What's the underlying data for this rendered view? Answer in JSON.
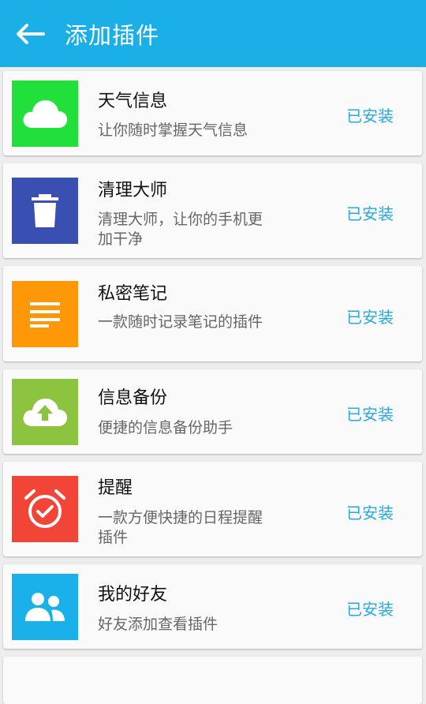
{
  "header": {
    "title": "添加插件",
    "back_icon": "arrow-left-icon"
  },
  "colors": {
    "accent": "#1aafe6",
    "status": "#2aa8de"
  },
  "plugins": [
    {
      "name": "天气信息",
      "desc": "让你随时掌握天气信息",
      "status": "已安装",
      "icon": "cloud-icon",
      "color": "#22e03c"
    },
    {
      "name": "清理大师",
      "desc": "清理大师，让你的手机更加干净",
      "status": "已安装",
      "icon": "trash-icon",
      "color": "#3a4fb2"
    },
    {
      "name": "私密笔记",
      "desc": "一款随时记录笔记的插件",
      "status": "已安装",
      "icon": "notes-icon",
      "color": "#ff9808"
    },
    {
      "name": "信息备份",
      "desc": "便捷的信息备份助手",
      "status": "已安装",
      "icon": "cloud-upload-icon",
      "color": "#8cc33f"
    },
    {
      "name": "提醒",
      "desc": "一款方便快捷的日程提醒插件",
      "status": "已安装",
      "icon": "alarm-icon",
      "color": "#f24537"
    },
    {
      "name": "我的好友",
      "desc": "好友添加查看插件",
      "status": "已安装",
      "icon": "people-icon",
      "color": "#1ab0ea"
    }
  ]
}
